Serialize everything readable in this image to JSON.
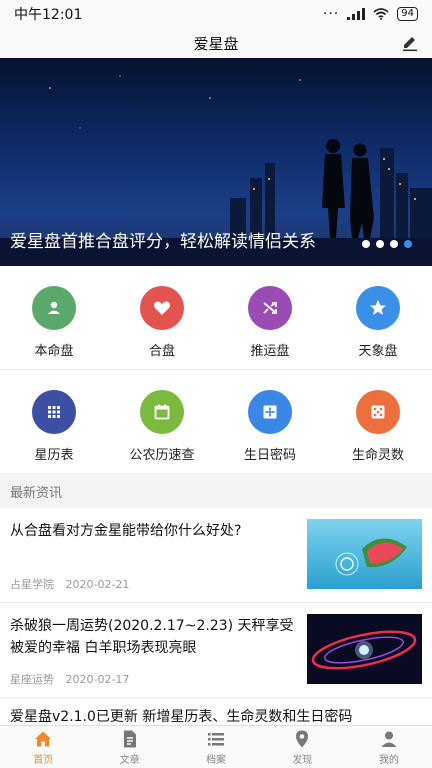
{
  "status": {
    "time": "中午12:01",
    "battery": "94"
  },
  "header": {
    "title": "爱星盘"
  },
  "banner": {
    "caption": "爱星盘首推合盘评分，轻松解读情侣关系",
    "dots": 4,
    "active_dot": 4
  },
  "grid": {
    "row1": [
      {
        "label": "本命盘",
        "icon": "person-icon",
        "color": "#5aa96a"
      },
      {
        "label": "合盘",
        "icon": "heart-icon",
        "color": "#e3544e"
      },
      {
        "label": "推运盘",
        "icon": "shuffle-icon",
        "color": "#9b4bb4"
      },
      {
        "label": "天象盘",
        "icon": "star-icon",
        "color": "#3a8fe6"
      }
    ],
    "row2": [
      {
        "label": "星历表",
        "icon": "grid-icon",
        "color": "#3d4fa5"
      },
      {
        "label": "公农历速查",
        "icon": "calendar-icon",
        "color": "#7cba3f"
      },
      {
        "label": "生日密码",
        "icon": "crosshair-icon",
        "color": "#3b87e6"
      },
      {
        "label": "生命灵数",
        "icon": "dice-icon",
        "color": "#ee6f3e"
      }
    ]
  },
  "news": {
    "header": "最新资讯",
    "items": [
      {
        "title": "从合盘看对方金星能带给你什么好处?",
        "source": "占星学院",
        "date": "2020-02-21"
      },
      {
        "title": "杀破狼一周运势(2020.2.17~2.23) 天秤享受被爱的幸福 白羊职场表现亮眼",
        "source": "星座运势",
        "date": "2020-02-17"
      },
      {
        "title": "爱星盘v2.1.0已更新 新增星历表、生命灵数和生日密码"
      }
    ]
  },
  "tabs": [
    {
      "label": "首页",
      "icon": "home-icon",
      "active": true
    },
    {
      "label": "文章",
      "icon": "article-icon"
    },
    {
      "label": "档案",
      "icon": "list-icon"
    },
    {
      "label": "发现",
      "icon": "location-icon"
    },
    {
      "label": "我的",
      "icon": "profile-icon"
    }
  ],
  "colors": {
    "accent": "#f0882b",
    "active_dot": "#3a8ee6"
  }
}
